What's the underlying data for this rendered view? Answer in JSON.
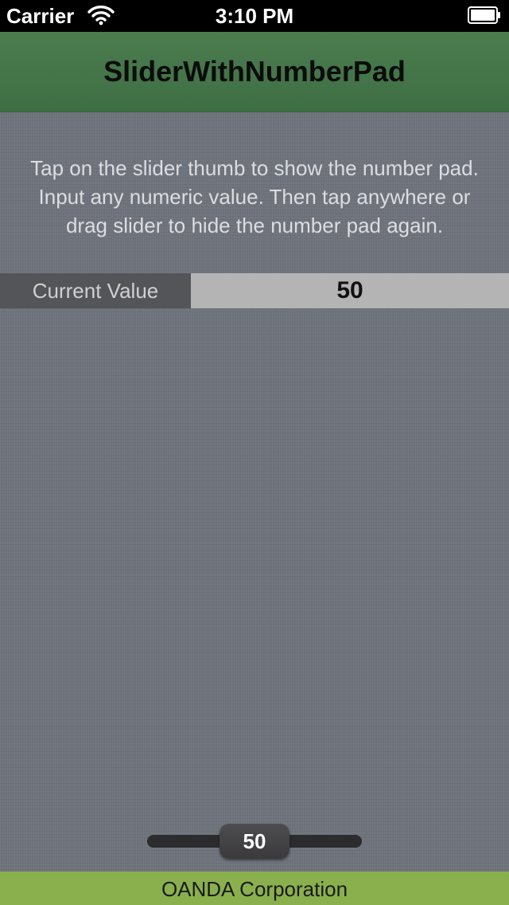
{
  "status_bar": {
    "carrier": "Carrier",
    "time": "3:10 PM",
    "icons": [
      "wifi-icon",
      "battery-icon"
    ]
  },
  "nav_bar": {
    "title": "SliderWithNumberPad",
    "color": "#437546"
  },
  "main": {
    "instructions": [
      "Tap on the slider thumb to show the number pad.",
      "Input any numeric value. Then tap anywhere or",
      "drag slider to hide the number pad again."
    ],
    "current_value": {
      "label": "Current Value",
      "value": "50"
    },
    "slider": {
      "value_label": "50",
      "level": 0.5
    }
  },
  "footer": {
    "text": "OANDA Corporation",
    "color": "#8ab04e"
  }
}
